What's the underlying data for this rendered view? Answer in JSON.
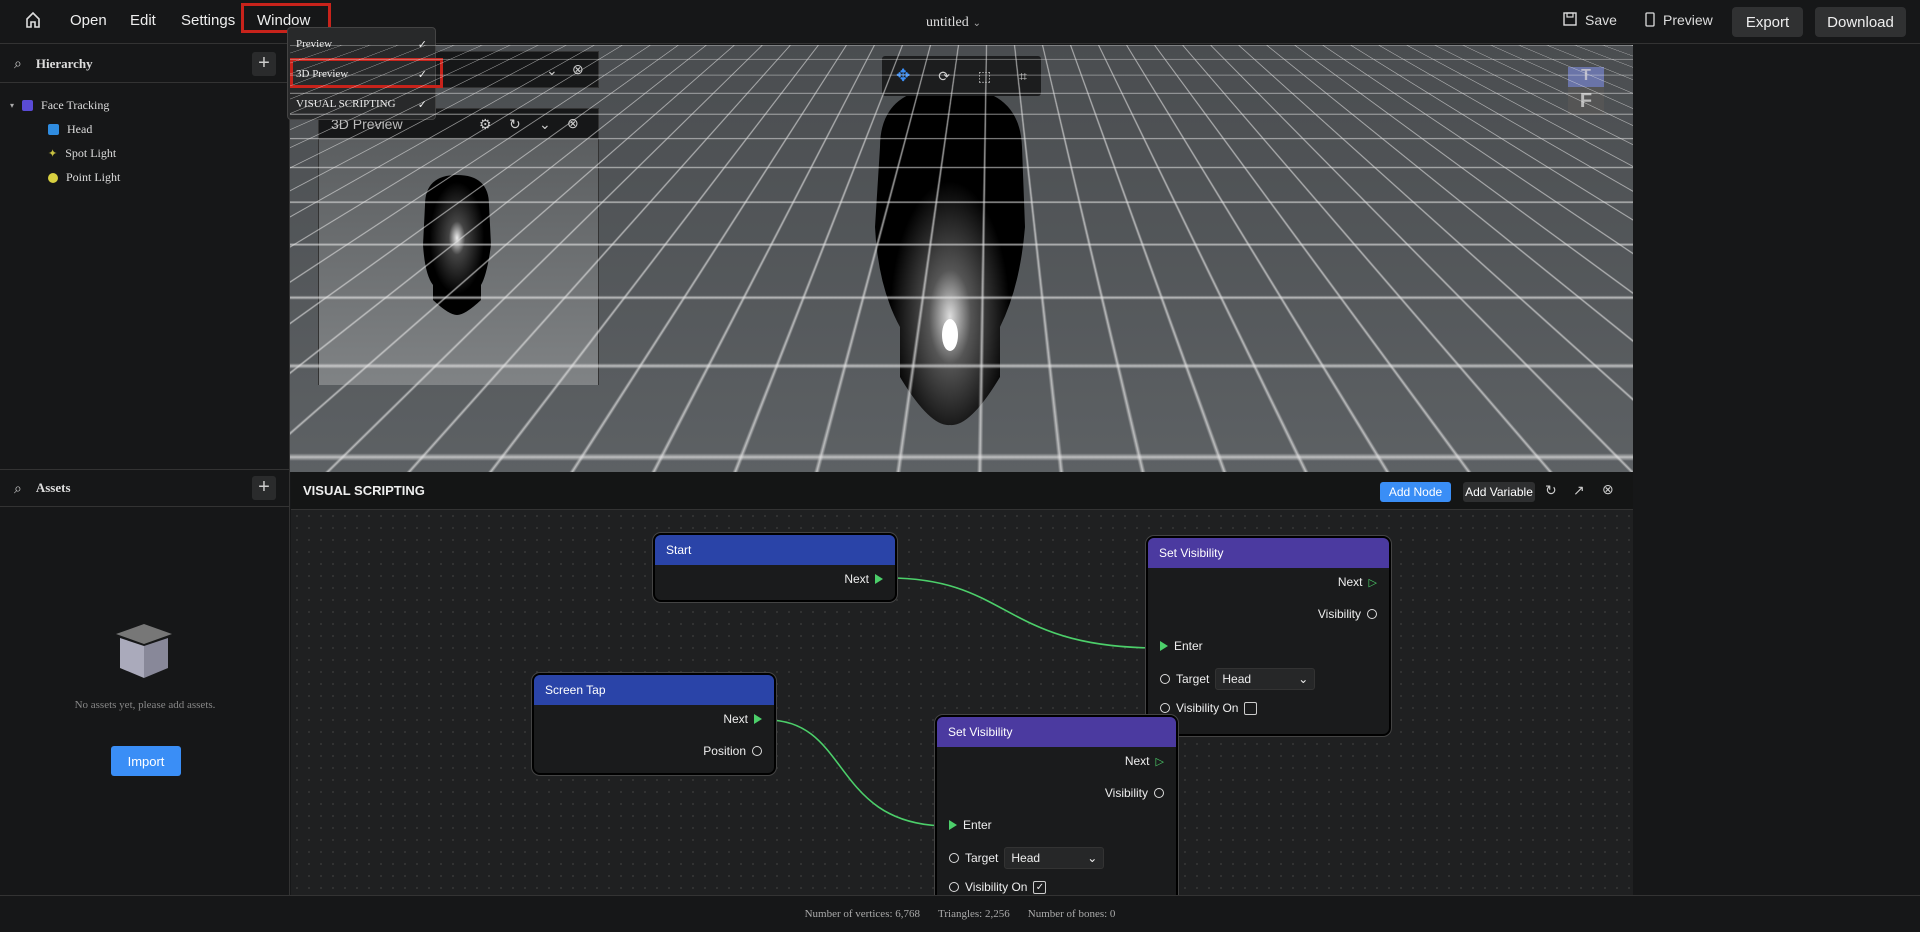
{
  "topbar": {
    "menus": [
      "Open",
      "Edit",
      "Settings",
      "Window"
    ],
    "title": "untitled",
    "save": "Save",
    "preview": "Preview",
    "export": "Export",
    "download": "Download"
  },
  "window_menu": {
    "items": [
      {
        "label": "Preview",
        "checked": true
      },
      {
        "label": "3D Preview",
        "checked": true
      },
      {
        "label": "VISUAL SCRIPTING",
        "checked": true
      }
    ]
  },
  "hierarchy": {
    "title": "Hierarchy",
    "items": [
      {
        "label": "Face Tracking",
        "icon": "face-tracking-icon"
      },
      {
        "label": "Head",
        "icon": "mesh-icon"
      },
      {
        "label": "Spot Light",
        "icon": "spot-light-icon"
      },
      {
        "label": "Point Light",
        "icon": "point-light-icon"
      }
    ]
  },
  "assets": {
    "title": "Assets",
    "empty": "No assets yet, please add assets.",
    "import": "Import"
  },
  "preview3d": {
    "title": "3D Preview"
  },
  "viewport": {
    "gizmo_top": "T",
    "gizmo_front": "F"
  },
  "visual_scripting": {
    "title": "VISUAL SCRIPTING",
    "add_node": "Add Node",
    "add_variable": "Add Variable",
    "nodes": {
      "start": {
        "title": "Start",
        "next": "Next"
      },
      "screen_tap": {
        "title": "Screen Tap",
        "next": "Next",
        "position": "Position"
      },
      "set_vis_1": {
        "title": "Set Visibility",
        "next": "Next",
        "visibility": "Visibility",
        "enter": "Enter",
        "target": "Target",
        "target_value": "Head",
        "visibility_on": "Visibility On",
        "visibility_on_checked": false
      },
      "set_vis_2": {
        "title": "Set Visibility",
        "next": "Next",
        "visibility": "Visibility",
        "enter": "Enter",
        "target": "Target",
        "target_value": "Head",
        "visibility_on": "Visibility On",
        "visibility_on_checked": true
      }
    }
  },
  "status": {
    "vertices": "Number of vertices: 6,768",
    "triangles": "Triangles: 2,256",
    "bones": "Number of bones: 0"
  },
  "colors": {
    "accent": "#3a8ef6",
    "highlight": "#c8231b",
    "node_blue": "#2a44a8",
    "node_purple": "#4b3aa0",
    "wire": "#4ccf6a"
  }
}
